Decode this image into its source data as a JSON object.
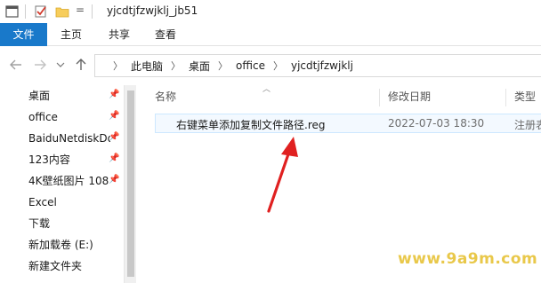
{
  "titlebar": {
    "title": "yjcdtjfzwjklj_jb51",
    "dropdown_glyph": "="
  },
  "ribbon": {
    "tabs": [
      "文件",
      "主页",
      "共享",
      "查看"
    ]
  },
  "address": {
    "crumbs": [
      "此电脑",
      "桌面",
      "office",
      "yjcdtjfzwjklj"
    ]
  },
  "sidebar": {
    "items": [
      {
        "label": "桌面",
        "pinned": true
      },
      {
        "label": "office",
        "pinned": true
      },
      {
        "label": "BaiduNetdiskDo",
        "pinned": true
      },
      {
        "label": "123内容",
        "pinned": true
      },
      {
        "label": "4K壁纸图片 108",
        "pinned": true
      },
      {
        "label": "Excel",
        "pinned": false
      },
      {
        "label": "下载",
        "pinned": false
      },
      {
        "label": "新加载卷 (E:)",
        "pinned": false
      },
      {
        "label": "新建文件夹",
        "pinned": false
      }
    ]
  },
  "content": {
    "columns": {
      "name": "名称",
      "modified": "修改日期",
      "type": "类型"
    },
    "files": [
      {
        "name": "右键菜单添加复制文件路径.reg",
        "modified": "2022-07-03 18:30",
        "type": "注册表"
      }
    ]
  },
  "watermark": "www.9a9m.com",
  "colors": {
    "accent": "#1979ca",
    "annotation_arrow": "#e02020",
    "watermark": "#e9c84a"
  }
}
